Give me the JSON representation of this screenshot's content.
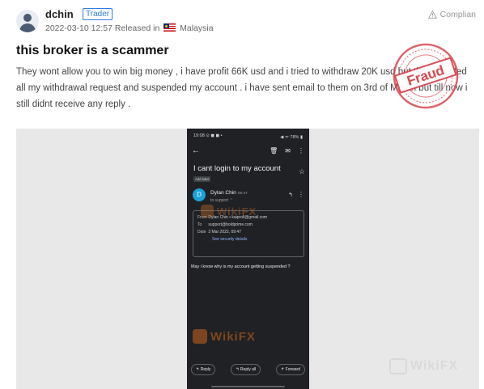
{
  "post": {
    "user": "dchin",
    "badge": "Trader",
    "date": "2022-03-10 12:57",
    "released_prefix": "Released in",
    "country": "Malaysia",
    "complain_label": "Complian",
    "title": "this broker is a scammer",
    "content": "They wont allow you to win big money , i have profit 66K usd and i tried to withdraw 20K usd but they rejected all my withdrawal request and suspended my account . i have sent email to them on 3rd of March but till now i still didnt receive any reply ."
  },
  "stamp": {
    "text": "Fraud",
    "color": "#d9474e"
  },
  "phone": {
    "status_left": "19:08 ⊙ ◼ ◼ •",
    "status_right": "◀ ᯤ 78% ▮",
    "subject": "I cant login to my account",
    "label": "Add label",
    "sender_initial": "D",
    "sender": "Dylan Chin",
    "time": "09:47",
    "to": "to support ⌃",
    "from_key": "From",
    "from_value": "Dylan Chin • kaiproll@gmail.com",
    "to_key": "To",
    "to_value": "support@boldprime.com",
    "date_key": "Date",
    "date_value": "3 Mar 2022, 09:47",
    "security_link": "See security details",
    "body": "May i know why is my account getting suspended ?",
    "actions": [
      "Reply",
      "Reply all",
      "Forward"
    ],
    "action_icons": [
      "↰",
      "↰",
      "↱"
    ]
  },
  "watermark": {
    "brand": "WikiFX"
  },
  "colors": {
    "badge": "#2f7de1",
    "phone_bg": "#202124",
    "gallery_bg": "#e8e8e8",
    "link": "#8ab4f8"
  }
}
